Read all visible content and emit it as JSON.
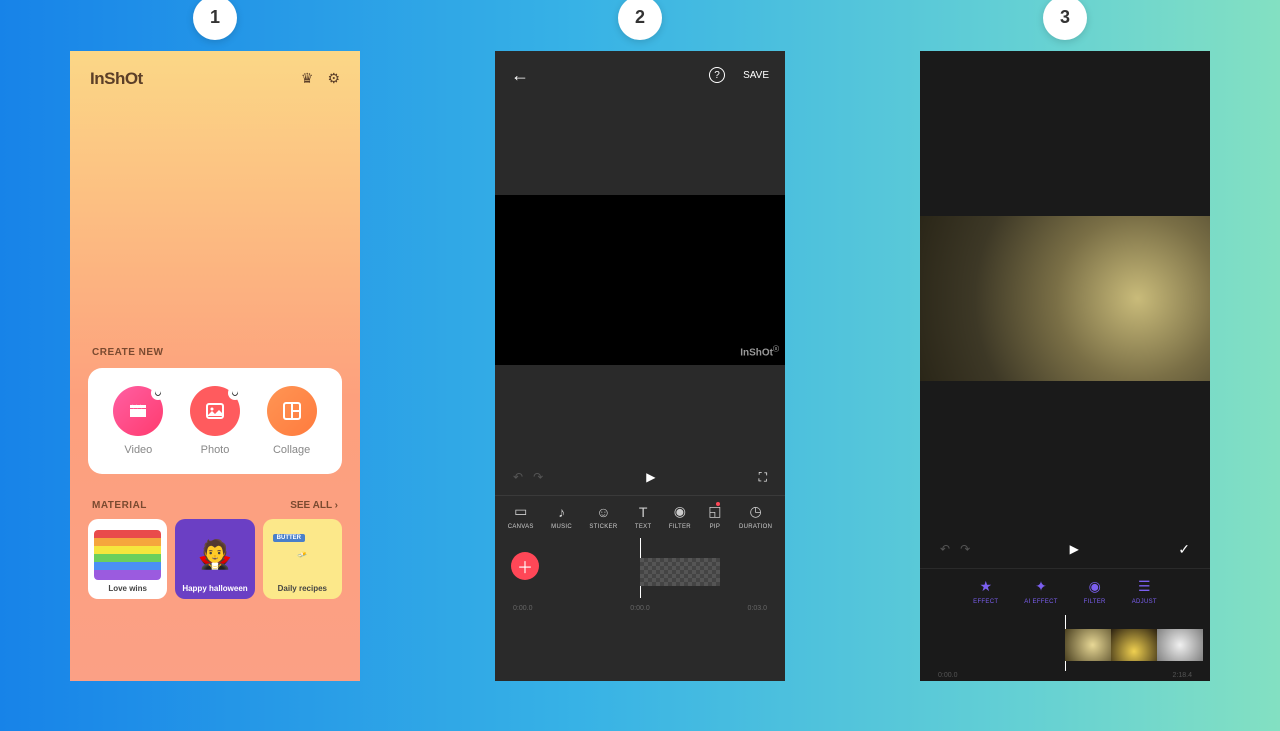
{
  "steps": [
    "1",
    "2",
    "3"
  ],
  "app": {
    "logo": "InShOt",
    "watermark": "InShOt"
  },
  "screen1": {
    "create_label": "CREATE NEW",
    "items": [
      {
        "label": "Video"
      },
      {
        "label": "Photo"
      },
      {
        "label": "Collage"
      }
    ],
    "material_label": "MATERIAL",
    "see_all": "SEE ALL ›",
    "materials": [
      {
        "label": "Love wins"
      },
      {
        "label": "Happy halloween"
      },
      {
        "label": "Daily recipes"
      }
    ]
  },
  "screen2": {
    "save": "SAVE",
    "tools": [
      {
        "label": "CANVAS"
      },
      {
        "label": "MUSIC"
      },
      {
        "label": "STICKER"
      },
      {
        "label": "TEXT"
      },
      {
        "label": "FILTER"
      },
      {
        "label": "PIP"
      },
      {
        "label": "DURATION"
      }
    ],
    "time_start": "0:00.0",
    "time_cur": "0:00.0",
    "time_end": "0:03.0"
  },
  "screen3": {
    "tabs": [
      {
        "label": "EFFECT"
      },
      {
        "label": "AI EFFECT"
      },
      {
        "label": "FILTER"
      },
      {
        "label": "ADJUST"
      }
    ],
    "time_start": "0:00.0",
    "time_end": "2:18.4"
  }
}
